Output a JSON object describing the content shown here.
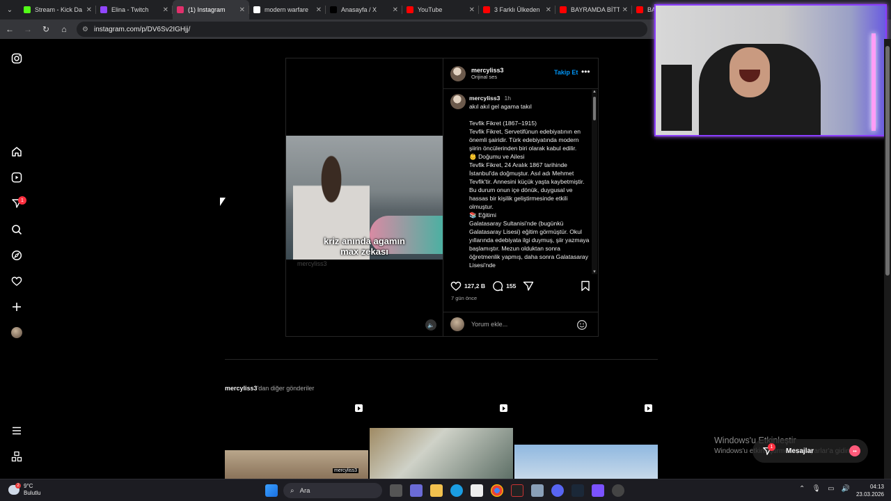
{
  "browser": {
    "tabs": [
      {
        "title": "Stream - Kick Da",
        "color": "#53fc18",
        "active": false
      },
      {
        "title": "Elina - Twitch",
        "color": "#9146ff",
        "active": false
      },
      {
        "title": "(1) Instagram",
        "color": "#e1306c",
        "active": true
      },
      {
        "title": "modern warfare",
        "color": "#ffffff",
        "active": false
      },
      {
        "title": "Anasayfa / X",
        "color": "#000000",
        "active": false
      },
      {
        "title": "YouTube",
        "color": "#ff0000",
        "active": false
      },
      {
        "title": "3 Farklı Ülkeden",
        "color": "#ff0000",
        "active": false
      },
      {
        "title": "BAYRAMDA BİTT",
        "color": "#ff0000",
        "active": false
      },
      {
        "title": "BA",
        "color": "#ff0000",
        "active": false
      }
    ],
    "url": "instagram.com/p/DV6Sv2IGHjj/"
  },
  "nav": {
    "icons": [
      "instagram-icon",
      "home-icon",
      "reels-icon",
      "messages-icon",
      "search-icon",
      "explore-icon",
      "notifications-icon",
      "create-icon",
      "profile-avatar",
      "menu-icon",
      "meta-icon"
    ],
    "messages_badge": "1"
  },
  "post": {
    "username": "mercyliss3",
    "audio": "Orijinal ses",
    "follow_label": "Takip Et",
    "video_caption_line1": "kriz anında agamın",
    "video_caption_line2": "max zekası",
    "watermark": "mercyliss3",
    "caption_time": "1h",
    "caption_lines": [
      "akıl akıl gel agama takıl",
      "",
      "Tevfik Fikret (1867–1915)",
      "Tevfik Fikret, Servetifünun edebiyatının en önemli şairidir. Türk edebiyatında modern şiirin öncülerinden biri olarak kabul edilir.",
      "👶 Doğumu ve Ailesi",
      "Tevfik Fikret, 24 Aralık 1867 tarihinde İstanbul'da doğmuştur. Asıl adı Mehmet Tevfik'tir. Annesini küçük yaşta kaybetmiştir. Bu durum onun içe dönük, duygusal ve hassas bir kişilik geliştirmesinde etkili olmuştur.",
      "📚 Eğitimi",
      "Galatasaray Sultanisi'nde (bugünkü Galatasaray Lisesi) eğitim görmüştür. Okul yıllarında edebiyata ilgi duymuş, şiir yazmaya başlamıştır. Mezun olduktan sonra öğretmenlik yapmış, daha sonra Galatasaray Lisesi'nde"
    ],
    "likes": "127,2 B",
    "comments": "155",
    "date": "7 gün önce",
    "comment_placeholder": "Yorum ekle..."
  },
  "more_posts": {
    "username": "mercyliss3",
    "suffix": "'dan diğer gönderiler",
    "cell_watermark": "mercyliss3"
  },
  "windows": {
    "activate_title": "Windows'u Etkinleştir",
    "activate_sub": "Windows'u etkinleştirmek için Ayarlar'a gidin."
  },
  "messages_pill": {
    "label": "Mesajlar",
    "badge": "1"
  },
  "taskbar": {
    "temp": "9°C",
    "weather": "Bulutlu",
    "weather_badge": "2",
    "search_placeholder": "Ara",
    "time": "04:13",
    "date": "23.03.2026"
  }
}
